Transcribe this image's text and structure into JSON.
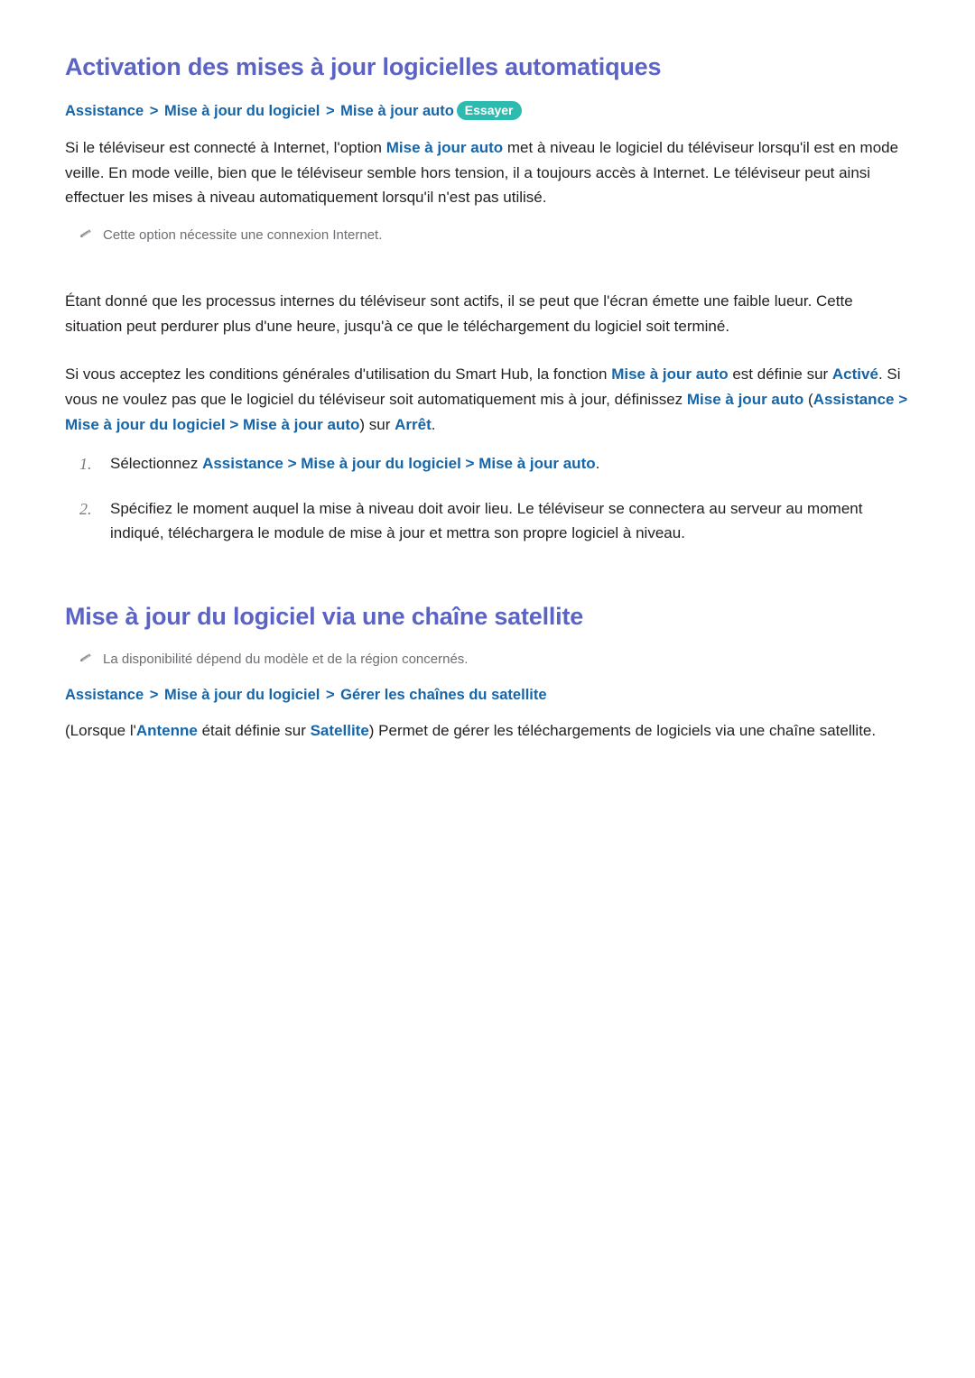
{
  "document": {
    "language": "fr",
    "background_color": "#ffffff",
    "body_text_color": "#231f20",
    "heading_color": "#5b63c4",
    "link_color": "#1565a8",
    "note_color": "#6e6e73",
    "badge_color": "#2dbbb0"
  },
  "section1": {
    "title": "Activation des mises à jour logicielles automatiques",
    "breadcrumb": {
      "items": [
        "Assistance",
        "Mise à jour du logiciel",
        "Mise à jour auto"
      ],
      "separator": ">",
      "badge": "Essayer"
    },
    "paragraph1": {
      "part1": "Si le téléviseur est connecté à Internet, l'option ",
      "term1": "Mise à jour auto",
      "part2": " met à niveau le logiciel du téléviseur lorsqu'il est en mode veille. En mode veille, bien que le téléviseur semble hors tension, il a toujours accès à Internet. Le téléviseur peut ainsi effectuer les mises à niveau automatiquement lorsqu'il n'est pas utilisé."
    },
    "note1": {
      "icon": "pencil-icon",
      "text": "Cette option nécessite une connexion Internet."
    },
    "paragraph2": "Étant donné que les processus internes du téléviseur sont actifs, il se peut que l'écran émette une faible lueur. Cette situation peut perdurer plus d'une heure, jusqu'à ce que le téléchargement du logiciel soit terminé.",
    "paragraph3": {
      "part1": "Si vous acceptez les conditions générales d'utilisation du Smart Hub, la fonction ",
      "term1": "Mise à jour auto",
      "part2": " est définie sur ",
      "term2": "Activé",
      "part3": ". Si vous ne voulez pas que le logiciel du téléviseur soit automatiquement mis à jour, définissez ",
      "term3": "Mise à jour auto",
      "part4": " (",
      "term4": "Assistance",
      "sep1": " > ",
      "term5": "Mise à jour du logiciel",
      "sep2": " > ",
      "term6": "Mise à jour auto",
      "part5": ") sur ",
      "term7": "Arrêt",
      "part6": "."
    },
    "steps": [
      {
        "number": "1.",
        "part1": "Sélectionnez ",
        "term1": "Assistance",
        "sep1": " > ",
        "term2": "Mise à jour du logiciel",
        "sep2": " > ",
        "term3": "Mise à jour auto",
        "part2": "."
      },
      {
        "number": "2.",
        "text": "Spécifiez le moment auquel la mise à niveau doit avoir lieu. Le téléviseur se connectera au serveur au moment indiqué, téléchargera le module de mise à jour et mettra son propre logiciel à niveau."
      }
    ]
  },
  "section2": {
    "title": "Mise à jour du logiciel via une chaîne satellite",
    "note1": {
      "icon": "pencil-icon",
      "text": "La disponibilité dépend du modèle et de la région concernés."
    },
    "breadcrumb": {
      "items": [
        "Assistance",
        "Mise à jour du logiciel",
        "Gérer les chaînes du satellite"
      ],
      "separator": ">"
    },
    "paragraph1": {
      "part1": "(Lorsque l'",
      "term1": "Antenne",
      "part2": " était définie sur ",
      "term2": "Satellite",
      "part3": ") Permet de gérer les téléchargements de logiciels via une chaîne satellite."
    }
  }
}
